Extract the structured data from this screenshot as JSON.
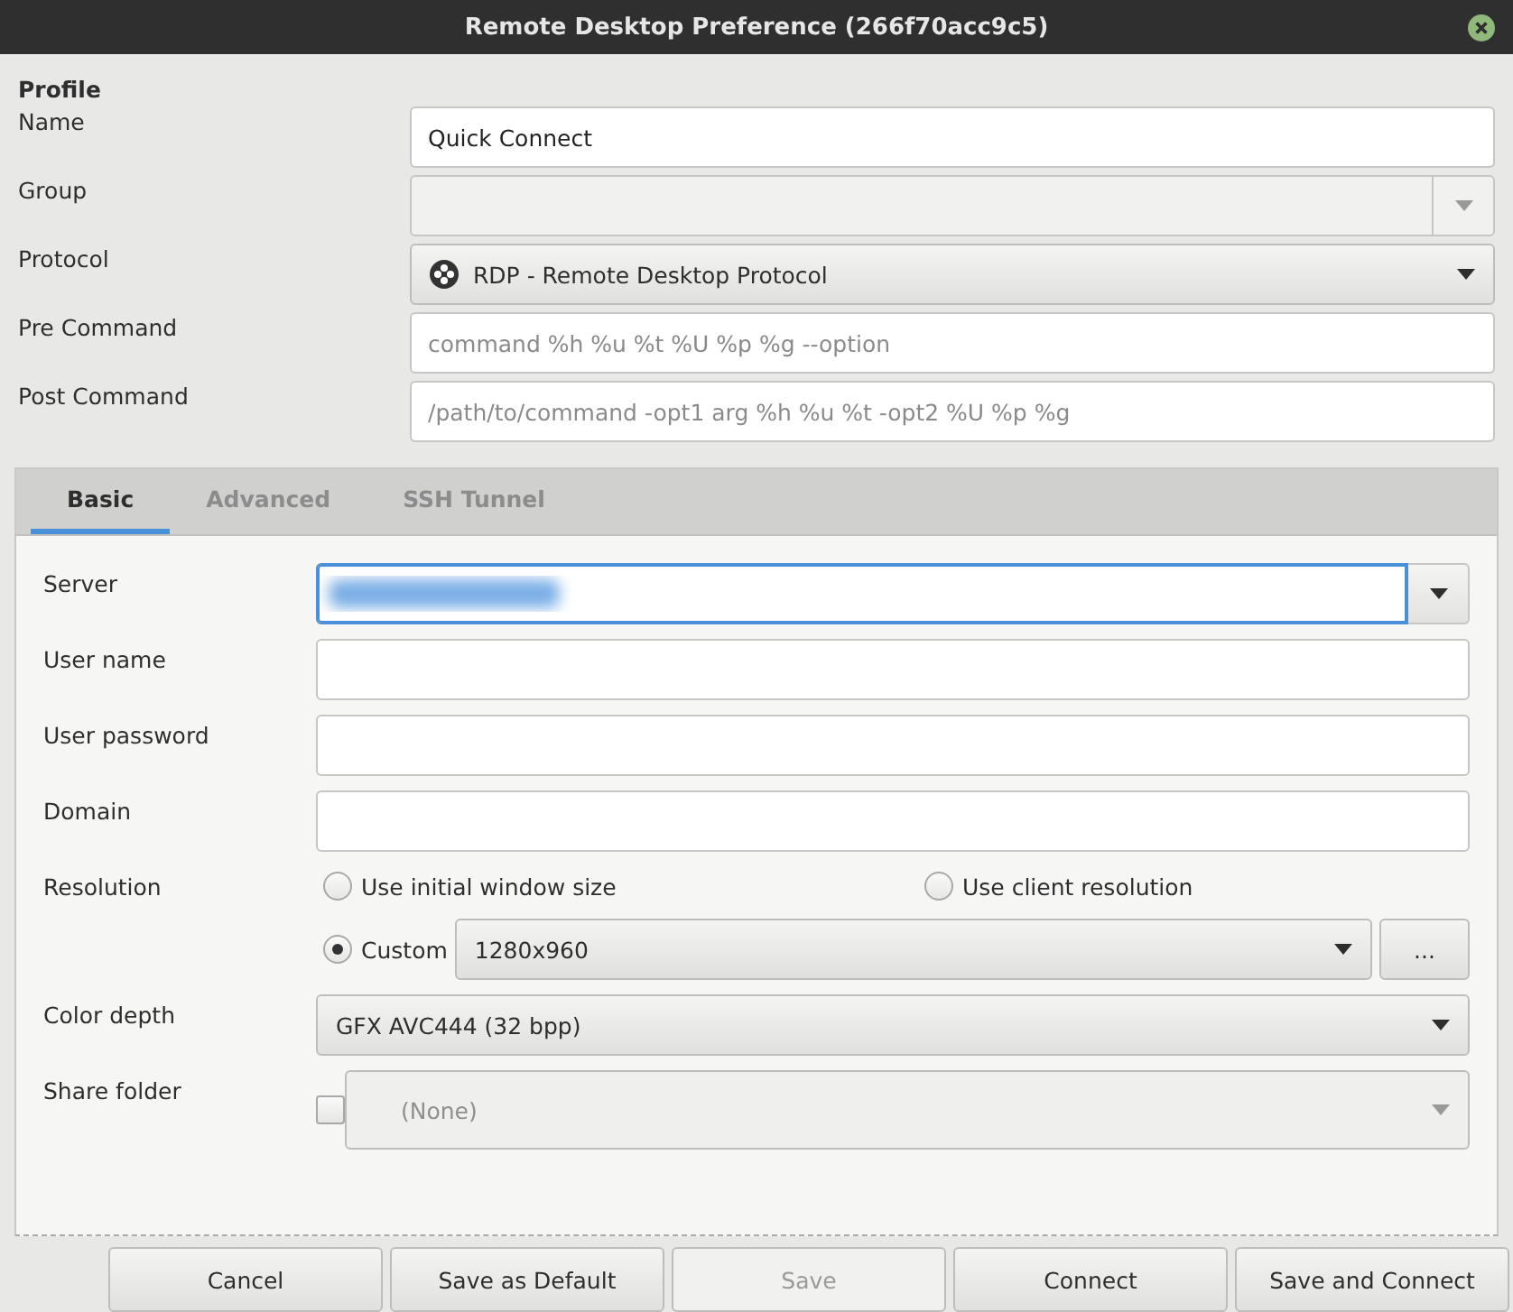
{
  "window": {
    "title": "Remote Desktop Preference (266f70acc9c5)"
  },
  "profile": {
    "heading": "Profile",
    "fields": [
      {
        "label": "Name",
        "kind": "entry",
        "value": "Quick Connect",
        "disabled": false
      },
      {
        "label": "Group",
        "kind": "combo_entry",
        "disabled": true
      },
      {
        "label": "Protocol",
        "kind": "dropdown",
        "value": "RDP - Remote Desktop Protocol",
        "disabled": false
      },
      {
        "label": "Pre Command",
        "kind": "entry",
        "placeholder": "command %h %u %t %U %p %g --option",
        "disabled": false
      },
      {
        "label": "Post Command",
        "kind": "entry",
        "placeholder": "/path/to/command -opt1 arg %h %u %t -opt2 %U %p %g",
        "disabled": false
      }
    ]
  },
  "tabs": [
    {
      "label": "Basic",
      "selected": true
    },
    {
      "label": "Advanced",
      "selected": false
    },
    {
      "label": "SSH Tunnel",
      "selected": false
    }
  ],
  "basic": {
    "fields": [
      {
        "label": "Server",
        "kind": "combo_entry",
        "focused": true,
        "blurred": true
      },
      {
        "label": "User name",
        "kind": "entry",
        "focused": false
      },
      {
        "label": "User password",
        "kind": "entry",
        "focused": false
      },
      {
        "label": "Domain",
        "kind": "entry",
        "focused": false
      }
    ],
    "resolution": {
      "label": "Resolution",
      "options": [
        {
          "label": "Use initial window size",
          "selected": false
        },
        {
          "label": "Use client resolution",
          "selected": false
        },
        {
          "label": "Custom",
          "selected": true
        }
      ],
      "custom_value": "1280x960",
      "more_button": "..."
    },
    "color_depth": {
      "label": "Color depth",
      "value": "GFX AVC444 (32 bpp)"
    },
    "share_folder": {
      "label": "Share folder",
      "checked": false,
      "value": "(None)"
    }
  },
  "buttons": [
    {
      "label": "Cancel",
      "disabled": false
    },
    {
      "label": "Save as Default",
      "disabled": false
    },
    {
      "label": "Save",
      "disabled": true
    },
    {
      "label": "Connect",
      "disabled": false
    },
    {
      "label": "Save and Connect",
      "disabled": false
    }
  ]
}
